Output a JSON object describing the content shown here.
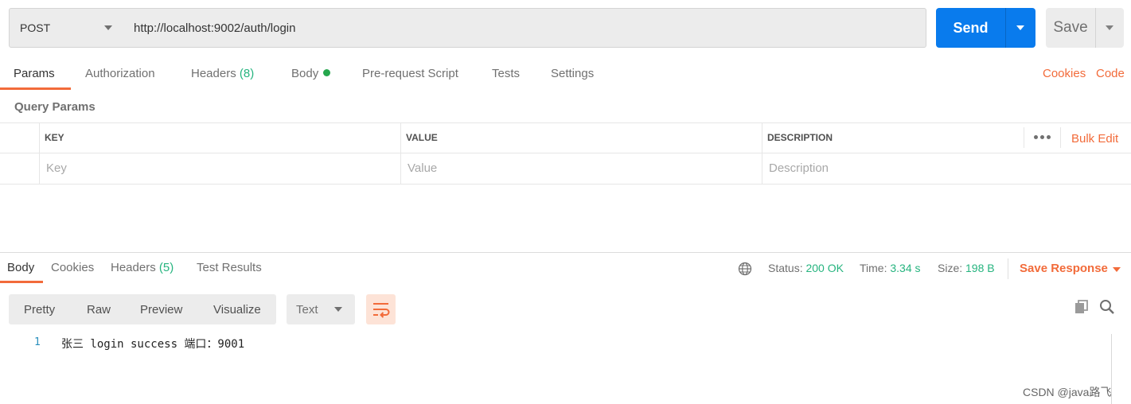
{
  "request": {
    "method": "POST",
    "url": "http://localhost:9002/auth/login",
    "send_label": "Send",
    "save_label": "Save"
  },
  "request_tabs": {
    "params": "Params",
    "authorization": "Authorization",
    "headers": "Headers",
    "headers_count": "(8)",
    "body": "Body",
    "prerequest": "Pre-request Script",
    "tests": "Tests",
    "settings": "Settings",
    "cookies": "Cookies",
    "code": "Code"
  },
  "query_params": {
    "title": "Query Params",
    "columns": {
      "key": "KEY",
      "value": "VALUE",
      "description": "DESCRIPTION"
    },
    "placeholders": {
      "key": "Key",
      "value": "Value",
      "description": "Description"
    },
    "bulk_edit": "Bulk Edit"
  },
  "response_tabs": {
    "body": "Body",
    "cookies": "Cookies",
    "headers": "Headers",
    "headers_count": "(5)",
    "test_results": "Test Results"
  },
  "response_status": {
    "status_label": "Status:",
    "status_value": "200 OK",
    "time_label": "Time:",
    "time_value": "3.34 s",
    "size_label": "Size:",
    "size_value": "198 B",
    "save_response": "Save Response"
  },
  "body_view": {
    "formats": [
      "Pretty",
      "Raw",
      "Preview",
      "Visualize"
    ],
    "type": "Text",
    "line_number": "1",
    "content": "张三 login success 端口：9001"
  },
  "watermark": "CSDN @java路飞",
  "colors": {
    "accent_orange": "#f26b3a",
    "send_blue": "#097bed",
    "success_green": "#26b47f"
  }
}
